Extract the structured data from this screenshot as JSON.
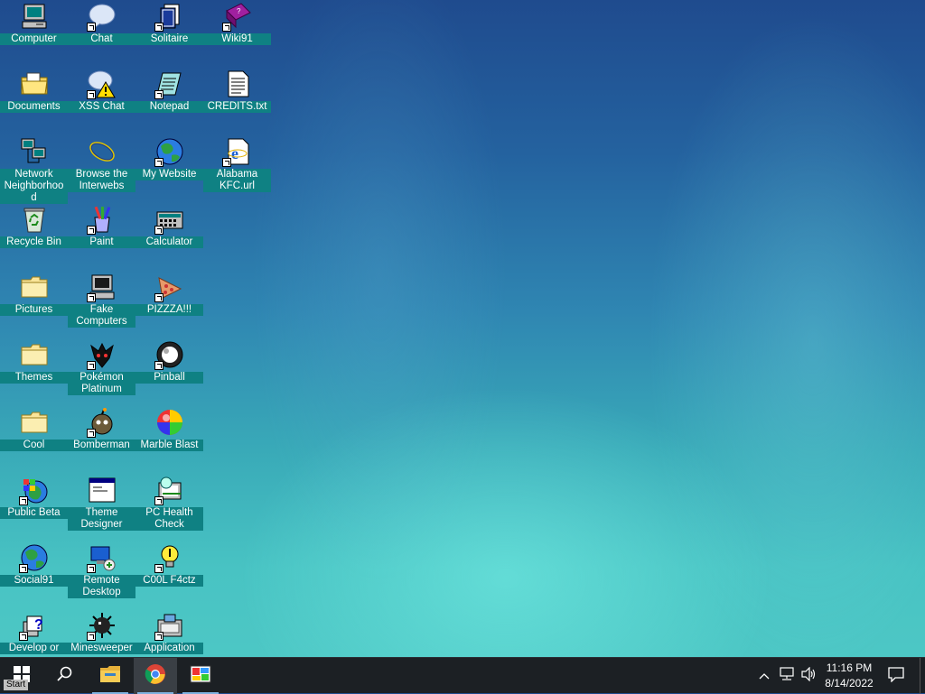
{
  "desktop": {
    "icons": [
      {
        "label": "Computer",
        "icon": "computer-icon"
      },
      {
        "label": "Chat",
        "icon": "chat-icon"
      },
      {
        "label": "Solitaire",
        "icon": "solitaire-icon"
      },
      {
        "label": "Wiki91",
        "icon": "wiki-book-icon"
      },
      {
        "label": "Documents",
        "icon": "folder-documents-icon"
      },
      {
        "label": "XSS Chat",
        "icon": "xss-chat-icon"
      },
      {
        "label": "Notepad",
        "icon": "notepad-icon"
      },
      {
        "label": "CREDITS.txt",
        "icon": "text-file-icon"
      },
      {
        "label": "Network Neighborhood",
        "icon": "network-icon"
      },
      {
        "label": "Browse the Interwebs",
        "icon": "browser-icon"
      },
      {
        "label": "My Website",
        "icon": "globe-icon"
      },
      {
        "label": "Alabama KFC.url",
        "icon": "url-file-icon"
      },
      {
        "label": "Recycle Bin",
        "icon": "recycle-bin-icon"
      },
      {
        "label": "Paint",
        "icon": "paint-icon"
      },
      {
        "label": "Calculator",
        "icon": "calculator-icon"
      },
      {
        "label": "Pictures",
        "icon": "folder-icon"
      },
      {
        "label": "Fake Computers",
        "icon": "computer-icon"
      },
      {
        "label": "PIZZZA!!!",
        "icon": "pizza-icon"
      },
      {
        "label": "Themes",
        "icon": "folder-icon"
      },
      {
        "label": "Pokémon Platinum",
        "icon": "pokemon-icon"
      },
      {
        "label": "Pinball",
        "icon": "pinball-icon"
      },
      {
        "label": "Cool",
        "icon": "folder-icon"
      },
      {
        "label": "Bomberman",
        "icon": "bomberman-icon"
      },
      {
        "label": "Marble Blast",
        "icon": "marble-icon"
      },
      {
        "label": "Public Beta",
        "icon": "windows-globe-icon"
      },
      {
        "label": "Theme Designer",
        "icon": "window-app-icon"
      },
      {
        "label": "PC Health Check",
        "icon": "health-check-icon"
      },
      {
        "label": "Social91",
        "icon": "globe-icon"
      },
      {
        "label": "Remote Desktop",
        "icon": "remote-desktop-icon"
      },
      {
        "label": "C00L F4ctz",
        "icon": "lightbulb-icon"
      },
      {
        "label": "Develop or",
        "icon": "help-icon"
      },
      {
        "label": "Minesweeper",
        "icon": "mine-icon"
      },
      {
        "label": "Application",
        "icon": "application-icon"
      }
    ]
  },
  "taskbar": {
    "start_text": "Start",
    "clock_time": "11:16 PM",
    "clock_date": "8/14/2022",
    "active_app": "chrome"
  },
  "colors": {
    "label_bg": "#0f8183",
    "taskbar_bg": "#1c2024",
    "accent": "#7fb2e0"
  }
}
